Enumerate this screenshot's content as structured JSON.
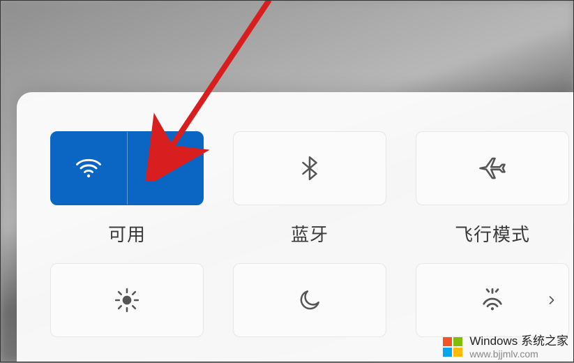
{
  "tiles": {
    "wifi": {
      "label": "可用",
      "active": true,
      "icon": "wifi-icon",
      "expand": true
    },
    "bluetooth": {
      "label": "蓝牙",
      "active": false,
      "icon": "bluetooth-icon",
      "expand": false
    },
    "airplane": {
      "label": "飞行模式",
      "active": false,
      "icon": "airplane-icon",
      "expand": false
    },
    "brightness": {
      "label": "",
      "active": false,
      "icon": "brightness-icon",
      "expand": false
    },
    "nightlight": {
      "label": "",
      "active": false,
      "icon": "moon-icon",
      "expand": false
    },
    "hotspot": {
      "label": "",
      "active": false,
      "icon": "hotspot-icon",
      "expand": true
    }
  },
  "colors": {
    "accent": "#0a66c2",
    "arrow": "#d81e1e"
  },
  "watermark": {
    "line1": "Windows 系统之家",
    "line2": "www.bjjmlv.com"
  }
}
